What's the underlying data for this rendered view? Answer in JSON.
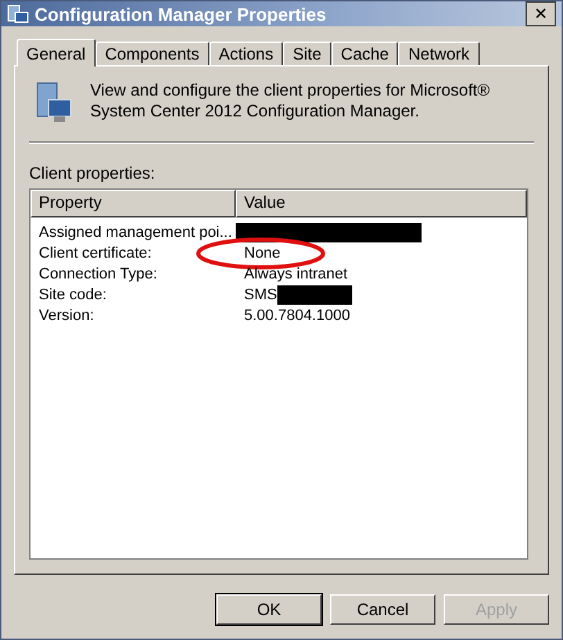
{
  "window": {
    "title": "Configuration Manager Properties",
    "close": "✕"
  },
  "tabs": [
    {
      "label": "General",
      "selected": true
    },
    {
      "label": "Components",
      "selected": false
    },
    {
      "label": "Actions",
      "selected": false
    },
    {
      "label": "Site",
      "selected": false
    },
    {
      "label": "Cache",
      "selected": false
    },
    {
      "label": "Network",
      "selected": false
    }
  ],
  "description": "View and configure the client properties for Microsoft® System Center 2012 Configuration Manager.",
  "client_properties": {
    "label": "Client properties:",
    "columns": [
      "Property",
      "Value"
    ],
    "rows": [
      {
        "property": "Assigned management poi...",
        "redacted": true
      },
      {
        "property": "Client certificate:",
        "value": "None",
        "circled": true
      },
      {
        "property": "Connection Type:",
        "value": "Always intranet"
      },
      {
        "property": "Site code:",
        "value": "SMS",
        "redacted": true
      },
      {
        "property": "Version:",
        "value": "5.00.7804.1000"
      }
    ]
  },
  "buttons": [
    {
      "label": "OK",
      "disabled": false,
      "default": true
    },
    {
      "label": "Cancel",
      "disabled": false,
      "default": false
    },
    {
      "label": "Apply",
      "disabled": true,
      "default": false
    }
  ]
}
